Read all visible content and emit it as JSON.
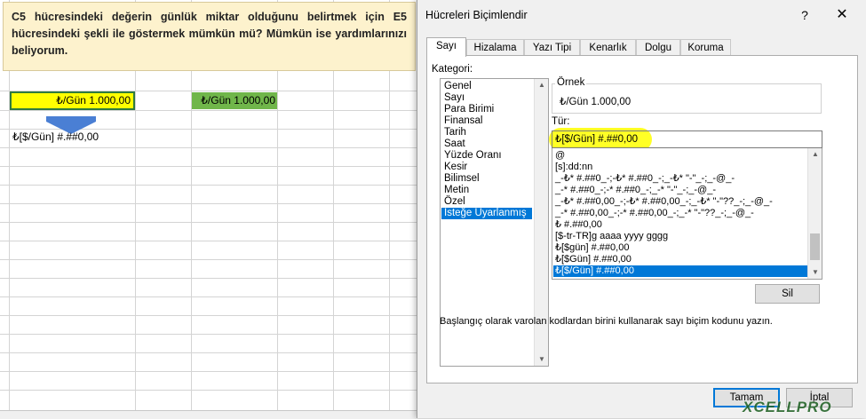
{
  "sheet": {
    "note_text": "C5 hücresindeki değerin günlük miktar olduğunu belirtmek için E5 hücresindeki şekli ile göstermek mümkün mü? Mümkün ise yardımlarınızı beliyorum.",
    "c5_value": "₺/Gün 1.000,00",
    "e5_value": "₺/Gün 1.000,00",
    "format_code_text": "₺[$/Gün] #.##0,00"
  },
  "dialog": {
    "title": "Hücreleri Biçimlendir",
    "help": "?",
    "close": "✕",
    "tabs": [
      "Sayı",
      "Hizalama",
      "Yazı Tipi",
      "Kenarlık",
      "Dolgu",
      "Koruma"
    ],
    "active_tab": "Sayı",
    "category_label": "Kategori:",
    "categories": [
      "Genel",
      "Sayı",
      "Para Birimi",
      "Finansal",
      "Tarih",
      "Saat",
      "Yüzde Oranı",
      "Kesir",
      "Bilimsel",
      "Metin",
      "Özel",
      "İsteğe Uyarlanmış"
    ],
    "selected_category": "İsteğe Uyarlanmış",
    "sample_label": "Örnek",
    "sample_value": "₺/Gün 1.000,00",
    "type_label": "Tür:",
    "type_value": "₺[$/Gün] #.##0,00",
    "format_codes": [
      "@",
      "[s]:dd:nn",
      "_-₺* #.##0_-;-₺* #.##0_-;_-₺* \"-\"_-;_-@_-",
      "_-* #.##0_-;-* #.##0_-;_-* \"-\"_-;_-@_-",
      "_-₺* #.##0,00_-;-₺* #.##0,00_-;_-₺* \"-\"??_-;_-@_-",
      "_-* #.##0,00_-;-* #.##0,00_-;_-* \"-\"??_-;_-@_-",
      "₺ #.##0,00",
      "[$-tr-TR]g aaaa yyyy gggg",
      "₺[$gün] #.##0,00",
      "₺[$Gün] #.##0,00",
      "₺[$/Gün] #.##0,00"
    ],
    "selected_code": "₺[$/Gün] #.##0,00",
    "delete_button": "Sil",
    "description": "Başlangıç olarak varolan kodlardan birini kullanarak sayı biçim kodunu yazın.",
    "ok_button": "Tamam",
    "cancel_button": "İptal"
  },
  "watermark": "XCELLPRO",
  "colors": {
    "selection": "#0078d7",
    "c5_fill": "#ffff00",
    "e5_fill": "#70b64a",
    "note_fill": "#fdf2cd",
    "highlight": "#ffff00"
  }
}
